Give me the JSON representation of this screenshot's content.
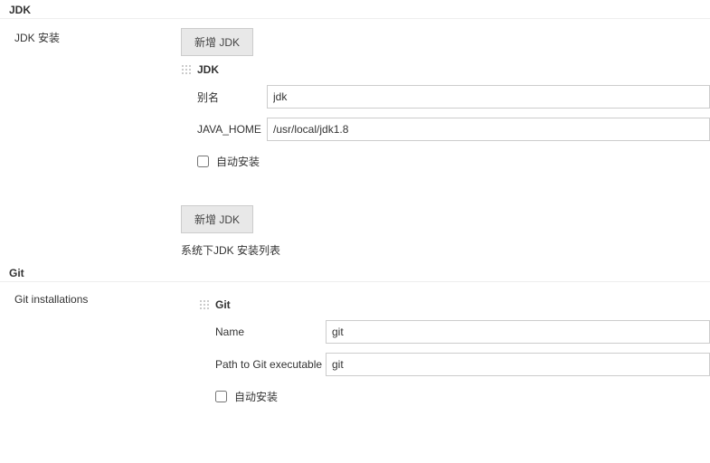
{
  "jdk": {
    "section_title": "JDK",
    "install_label": "JDK 安装",
    "add_button": "新增 JDK",
    "item_title": "JDK",
    "alias_label": "别名",
    "alias_value": "jdk",
    "java_home_label": "JAVA_HOME",
    "java_home_value": "/usr/local/jdk1.8",
    "auto_install_label": "自动安装",
    "add_button2": "新增 JDK",
    "system_list_hint": "系统下JDK 安装列表"
  },
  "git": {
    "section_title": "Git",
    "installations_label": "Git installations",
    "item_title": "Git",
    "name_label": "Name",
    "name_value": "git",
    "path_label": "Path to Git executable",
    "path_value": "git",
    "auto_install_label": "自动安装"
  }
}
